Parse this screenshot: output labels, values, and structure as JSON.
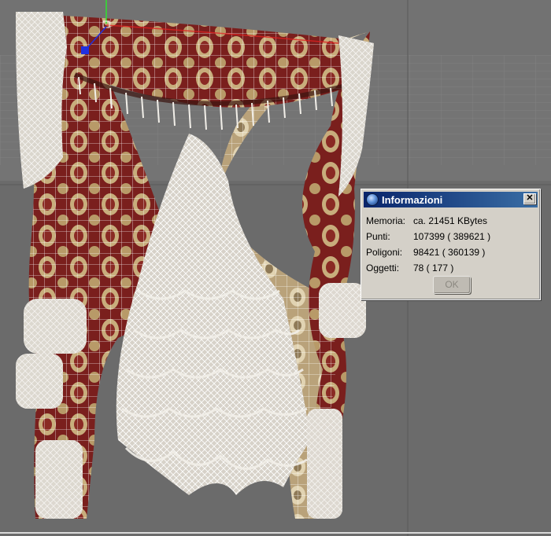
{
  "dialog": {
    "title": "Informazioni",
    "close_label": "✕",
    "rows": [
      {
        "label": "Memoria:",
        "value": "ca. 21451 KBytes"
      },
      {
        "label": "Punti:",
        "value": "107399 ( 389621 )"
      },
      {
        "label": "Poligoni:",
        "value": "98421 ( 360139 )"
      },
      {
        "label": "Oggetti:",
        "value": "78 ( 177 )"
      }
    ],
    "ok_label": "OK"
  },
  "colors": {
    "viewport_bg": "#6b6b6b",
    "curtain_red": "#7a1f1d",
    "curtain_gold": "#c9b48a",
    "lace": "#e6e2da",
    "wire": "#ffffff",
    "titlebar": "#08246b"
  },
  "icons": {
    "dialog": "info-sphere-icon",
    "close": "close-icon",
    "axis_gizmo": "axis-gizmo-icon"
  }
}
